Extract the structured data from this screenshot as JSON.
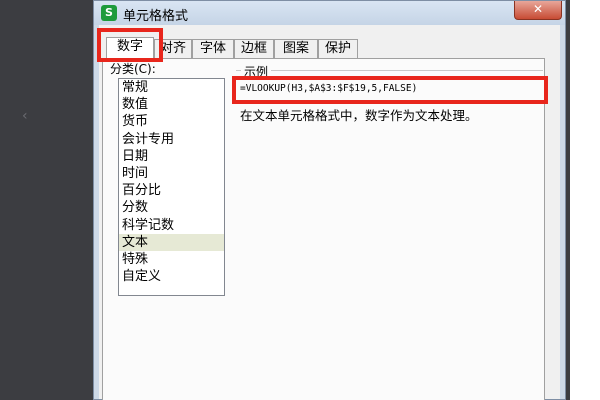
{
  "dialog": {
    "title": "单元格格式",
    "app_icon": "S",
    "close_glyph": "✕"
  },
  "tabs": [
    {
      "label": "数字",
      "active": true
    },
    {
      "label": "对齐",
      "active": false
    },
    {
      "label": "字体",
      "active": false
    },
    {
      "label": "边框",
      "active": false
    },
    {
      "label": "图案",
      "active": false
    },
    {
      "label": "保护",
      "active": false
    }
  ],
  "category": {
    "label": "分类(C):",
    "items": [
      "常规",
      "数值",
      "货币",
      "会计专用",
      "日期",
      "时间",
      "百分比",
      "分数",
      "科学记数",
      "文本",
      "特殊",
      "自定义"
    ],
    "selected": "文本"
  },
  "sample": {
    "title": "示例",
    "value": "=VLOOKUP(H3,$A$3:$F$19,5,FALSE)"
  },
  "description": "在文本单元格格式中，数字作为文本处理。",
  "colors": {
    "highlight": "#e8261c",
    "selected_item": "#e6e9d5"
  }
}
